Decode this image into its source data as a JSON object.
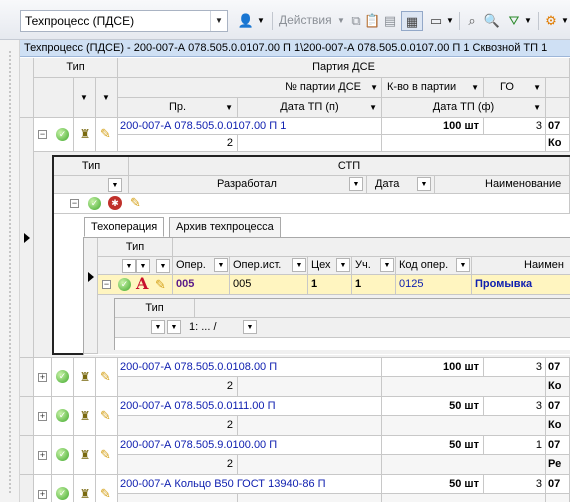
{
  "toolbar": {
    "combo_value": "Техпроцесс (ПДСЕ)",
    "actions_label": "Действия"
  },
  "title": "Техпроцесс (ПДСЕ) - 200-007-А 078.505.0.0107.00 П 1\\200-007-А 078.505.0.0107.00 П 1 Сквозной ТП 1",
  "headers": {
    "type": "Тип",
    "party": "Партия ДСЕ",
    "party_no": "№ партии ДСЕ",
    "qty": "К-во в партии",
    "go": "ГО",
    "pr": "Пр.",
    "date_tp_plan": "Дата ТП (п)",
    "date_tp_fact": "Дата ТП (ф)"
  },
  "rows": [
    {
      "name": "200-007-А 078.505.0.0107.00 П 1",
      "qty": "100 шт",
      "go": "3",
      "extra1": "07",
      "pr": "2",
      "extra2": "Ко"
    },
    {
      "name": "200-007-А 078.505.0.0108.00 П",
      "qty": "100 шт",
      "go": "3",
      "extra1": "07",
      "pr": "2",
      "extra2": "Ко"
    },
    {
      "name": "200-007-А 078.505.0.0111.00 П",
      "qty": "50 шт",
      "go": "3",
      "extra1": "07",
      "pr": "2",
      "extra2": "Ко"
    },
    {
      "name": "200-007-А 078.505.9.0100.00 П",
      "qty": "50 шт",
      "go": "1",
      "extra1": "07",
      "pr": "2",
      "extra2": "Ре"
    },
    {
      "name": "200-007-А Кольцо В50 ГОСТ 13940-86 П",
      "qty": "50 шт",
      "go": "3",
      "extra1": "07",
      "pr": "",
      "extra2": ""
    }
  ],
  "stp": {
    "type": "Тип",
    "title": "СТП",
    "developer": "Разработал",
    "date": "Дата",
    "name": "Наименование"
  },
  "tabs": [
    "Техоперация",
    "Архив техпроцесса"
  ],
  "oper": {
    "type": "Тип",
    "col_oper": "Опер.",
    "col_oper_src": "Опер.ист.",
    "col_shop": "Цех",
    "col_area": "Уч.",
    "col_code": "Код опер.",
    "col_name": "Наимен",
    "row": {
      "oper": "005",
      "oper_src": "005",
      "shop": "1",
      "area": "1",
      "code": "0125",
      "name": "Промывка"
    }
  },
  "sub": {
    "type": "Тип",
    "filter": "1: ...  /"
  },
  "colors": {
    "title_bg": "#cfe0f4",
    "selected_row": "#fff5c0",
    "link": "#1020b0",
    "accent": "#3fa82b"
  }
}
